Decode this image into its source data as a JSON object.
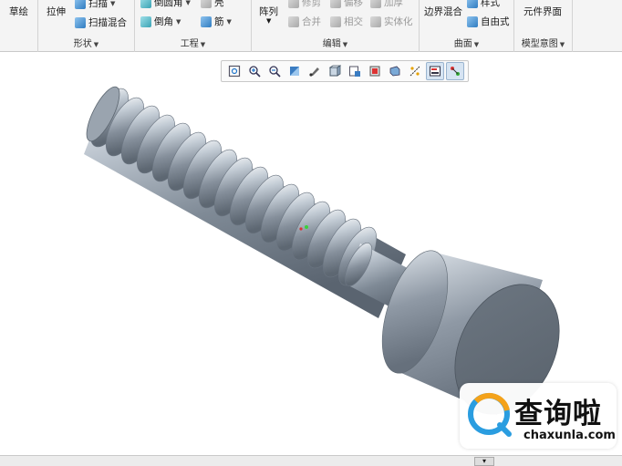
{
  "ribbon": {
    "groups": {
      "shape": {
        "title": "形状"
      },
      "engineering": {
        "title": "工程"
      },
      "edit": {
        "title": "编辑"
      },
      "surface": {
        "title": "曲面"
      },
      "model_intent": {
        "title": "模型意图"
      }
    },
    "sketch_label": "草绘",
    "extrude_label": "拉伸",
    "sweep_label": "扫描",
    "swept_blend_label": "扫描混合",
    "round_label": "倒圆角",
    "shell_label": "壳",
    "chamfer_label": "倒角",
    "rib_label": "筋",
    "pattern_label": "阵列",
    "trim_label": "修剪",
    "offset_label": "偏移",
    "thicken_label": "加厚",
    "merge_label": "合并",
    "intersect_label": "相交",
    "solidify_label": "实体化",
    "boundary_blend_label": "边界混合",
    "style_label": "样式",
    "freestyle_label": "自由式",
    "component_interface_label": "元件界面"
  },
  "view_toolbar": {
    "icons": [
      "zoom-fit-icon",
      "zoom-in-icon",
      "zoom-out-icon",
      "repaint-icon",
      "reorient-icon",
      "display-style-icon",
      "saved-orientations-icon",
      "view-manager-icon",
      "perspective-icon",
      "datum-display-icon",
      "annotation-display-icon",
      "spin-center-icon"
    ]
  },
  "watermark": {
    "text_cn": "查询啦",
    "text_en": "chaxunla.com"
  },
  "status": {
    "icon": "filter-icon"
  }
}
